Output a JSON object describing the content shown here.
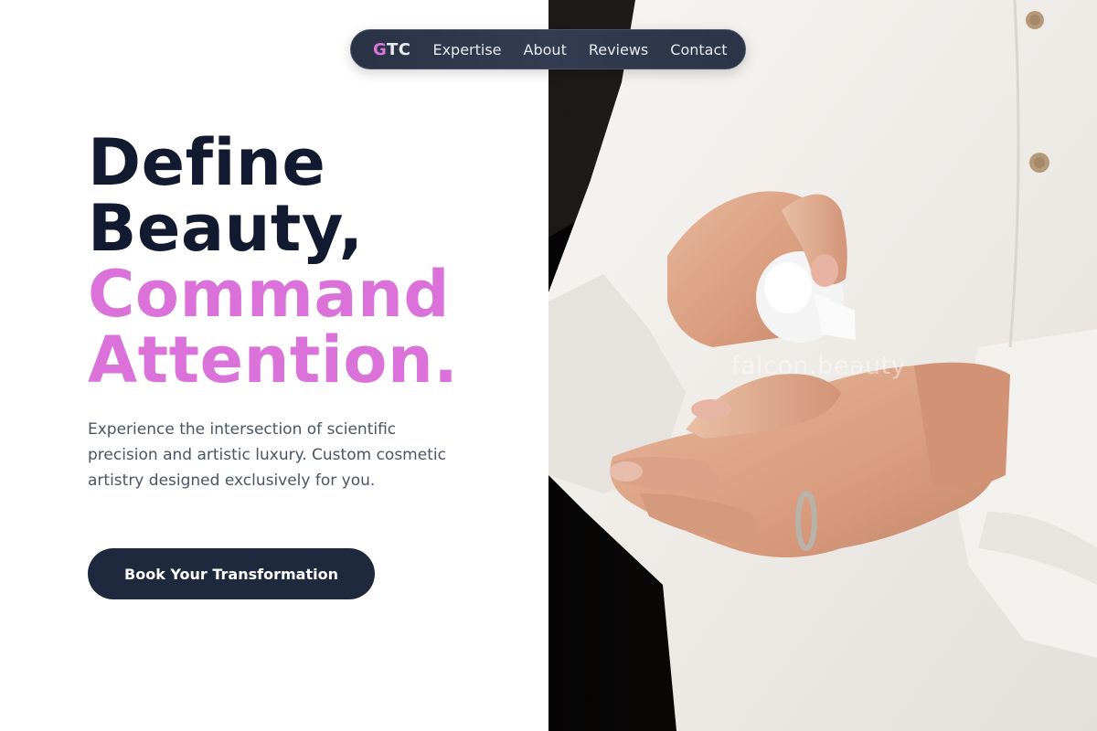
{
  "nav": {
    "logo_first": "G",
    "logo_rest": "TC",
    "links": [
      "Expertise",
      "About",
      "Reviews",
      "Contact"
    ]
  },
  "hero": {
    "headline_line1": "Define",
    "headline_line2": "Beauty,",
    "headline_line3": "Command",
    "headline_line4": "Attention.",
    "subtext": "Experience the intersection of scientific precision and artistic luxury. Custom cosmetic artistry designed exclusively for you.",
    "cta_label": "Book Your Transformation"
  },
  "photo": {
    "watermark": "falcon.beauty",
    "subject_icon": "hands-applying-lotion-photo"
  },
  "colors": {
    "accent": "#da72d9",
    "dark_text": "#111a2e",
    "nav_bg": "#2f384b",
    "button_bg": "#1e293d",
    "body_text": "#4b5465"
  }
}
